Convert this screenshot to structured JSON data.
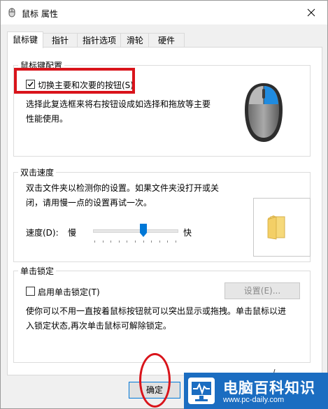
{
  "window": {
    "title": "鼠标 属性",
    "close_glyph": "✕"
  },
  "tabs": [
    {
      "label": "鼠标键",
      "active": true
    },
    {
      "label": "指针",
      "active": false
    },
    {
      "label": "指针选项",
      "active": false
    },
    {
      "label": "滑轮",
      "active": false
    },
    {
      "label": "硬件",
      "active": false
    }
  ],
  "button_config": {
    "title": "鼠标键配置",
    "switch_checkbox_label": "切换主要和次要的按钮(S)",
    "switch_checked": true,
    "description_line1": "选择此复选框来将右按钮设成如选择和拖放等主要",
    "description_line2": "性能使用。",
    "mouse_icon": "mouse-icon"
  },
  "double_click": {
    "title": "双击速度",
    "description_line1": "双击文件夹以检测你的设置。如果文件夹没打开或关",
    "description_line2": "闭，请用慢一点的设置再试一次。",
    "speed_label": "速度(D):",
    "slow_label": "慢",
    "fast_label": "快",
    "speed_level": 0.6,
    "folder_icon": "folder-icon"
  },
  "click_lock": {
    "title": "单击锁定",
    "checkbox_label": "启用单击锁定(T)",
    "checked": false,
    "settings_button": "设置(E)...",
    "description_line1": "使你可以不用一直按着鼠标按钮就可以突出显示或拖拽。单击鼠标以进",
    "description_line2": "入锁定状态,再次单击鼠标可解除锁定。"
  },
  "footer": {
    "ok_button": "确定"
  },
  "watermark": {
    "title": "电脑百科知识",
    "url": "www.pc-daily.com",
    "icon": "monitor-pulse-icon"
  },
  "colors": {
    "annotation_red": "#d9141b",
    "watermark_blue": "#1b6dc1",
    "slider_blue": "#0078d7"
  }
}
